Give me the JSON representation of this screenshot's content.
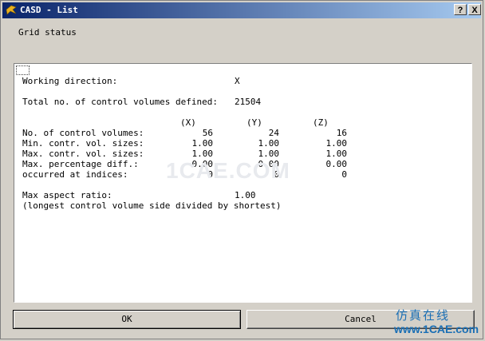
{
  "window": {
    "title": "CASD - List",
    "help_label": "?",
    "close_label": "X",
    "caption": "Grid status"
  },
  "listing": {
    "working_direction_label": "Working direction:",
    "working_direction_value": "X",
    "total_label": "Total no. of control volumes defined:",
    "total_value": "21504",
    "col_headers": [
      "(X)",
      "(Y)",
      "(Z)"
    ],
    "rows": [
      {
        "label": "No. of control volumes:",
        "values": [
          "56",
          "24",
          "16"
        ]
      },
      {
        "label": "Min. contr. vol. sizes:",
        "values": [
          "1.00",
          "1.00",
          "1.00"
        ]
      },
      {
        "label": "Max. contr. vol. sizes:",
        "values": [
          "1.00",
          "1.00",
          "1.00"
        ]
      },
      {
        "label": "Max. percentage diff.:",
        "values": [
          "0.00",
          "0.00",
          "0.00"
        ]
      },
      {
        "label": "occurred at indices:",
        "values": [
          "0",
          "0",
          "0"
        ]
      }
    ],
    "aspect_label": "Max aspect ratio:",
    "aspect_value": "1.00",
    "aspect_note": "(longest control volume side divided by shortest)"
  },
  "buttons": {
    "ok_label": "OK",
    "cancel_label": "Cancel"
  },
  "watermark": {
    "center_text": "1CAE.COM",
    "cn_text": "仿真在线",
    "url_text": "www.1CAE.com"
  }
}
